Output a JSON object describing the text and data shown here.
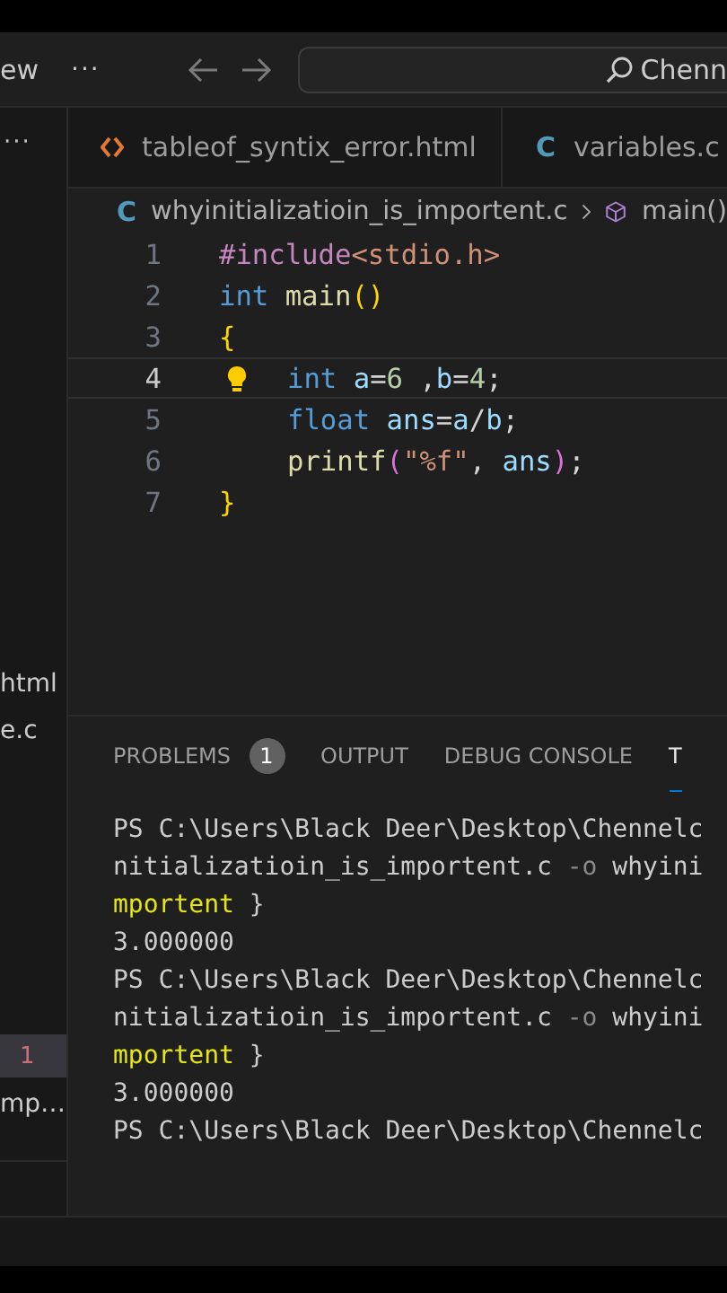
{
  "title_bar": {
    "menu_label": "ew",
    "more": "···",
    "search": {
      "value": "Chenn"
    }
  },
  "sidebar": {
    "more": "···",
    "items": [
      {
        "label": "html"
      },
      {
        "label": "e.c"
      }
    ],
    "badge_row": {
      "badge": "1"
    },
    "last_item": {
      "label": "mp…"
    }
  },
  "tabs": [
    {
      "label": "tableof_syntix_error.html",
      "kind": "html"
    },
    {
      "label": "variables.c",
      "kind": "c",
      "icon": "C"
    }
  ],
  "breadcrumb": {
    "icon": "C",
    "file": "whyinitializatioin_is_importent.c",
    "symbol": "main()"
  },
  "code_lines": [
    {
      "number": "1",
      "current": false,
      "indented": false,
      "lightbulb": false,
      "tokens": [
        {
          "text": "#include",
          "kind": "directive"
        },
        {
          "text": "<stdio.h>",
          "kind": "header"
        }
      ]
    },
    {
      "number": "2",
      "current": false,
      "indented": false,
      "lightbulb": false,
      "tokens": [
        {
          "text": "int",
          "kind": "keyword"
        },
        {
          "text": " main",
          "kind": "function"
        },
        {
          "text": "()",
          "kind": "bracket"
        }
      ]
    },
    {
      "number": "3",
      "current": false,
      "indented": false,
      "lightbulb": false,
      "tokens": [
        {
          "text": "{",
          "kind": "bracket"
        }
      ]
    },
    {
      "number": "4",
      "current": true,
      "indented": true,
      "lightbulb": true,
      "tokens": [
        {
          "text": "int",
          "kind": "keyword"
        },
        {
          "text": " a",
          "kind": "variable"
        },
        {
          "text": "=",
          "kind": "plain"
        },
        {
          "text": "6",
          "kind": "number"
        },
        {
          "text": " ,",
          "kind": "plain"
        },
        {
          "text": "b",
          "kind": "variable"
        },
        {
          "text": "=",
          "kind": "plain"
        },
        {
          "text": "4",
          "kind": "number"
        },
        {
          "text": ";",
          "kind": "plain"
        }
      ]
    },
    {
      "number": "5",
      "current": false,
      "indented": true,
      "lightbulb": false,
      "tokens": [
        {
          "text": "float",
          "kind": "keyword"
        },
        {
          "text": " ans",
          "kind": "variable"
        },
        {
          "text": "=",
          "kind": "plain"
        },
        {
          "text": "a",
          "kind": "variable"
        },
        {
          "text": "/",
          "kind": "plain"
        },
        {
          "text": "b",
          "kind": "variable"
        },
        {
          "text": ";",
          "kind": "plain"
        }
      ]
    },
    {
      "number": "6",
      "current": false,
      "indented": true,
      "lightbulb": false,
      "tokens": [
        {
          "text": "printf",
          "kind": "function"
        },
        {
          "text": "(",
          "kind": "bracket2"
        },
        {
          "text": "\"%f\"",
          "kind": "string"
        },
        {
          "text": ",",
          "kind": "plain"
        },
        {
          "text": " ans",
          "kind": "variable"
        },
        {
          "text": ")",
          "kind": "bracket2"
        },
        {
          "text": ";",
          "kind": "plain"
        }
      ]
    },
    {
      "number": "7",
      "current": false,
      "indented": false,
      "lightbulb": false,
      "tokens": [
        {
          "text": "}",
          "kind": "bracket"
        }
      ]
    }
  ],
  "panel_tabs": [
    {
      "label": "PROBLEMS",
      "badge": "1",
      "selected": false
    },
    {
      "label": "OUTPUT",
      "selected": false
    },
    {
      "label": "DEBUG CONSOLE",
      "selected": false
    },
    {
      "label": "T",
      "selected": true
    }
  ],
  "terminal_lines": [
    [
      {
        "text": "PS C:\\Users\\Black Deer\\Desktop\\Chennelc",
        "kind": "plain"
      }
    ],
    [
      {
        "text": "nitializatioin_is_importent.c ",
        "kind": "plain"
      },
      {
        "text": "-o",
        "kind": "flag"
      },
      {
        "text": " whyini",
        "kind": "plain"
      }
    ],
    [
      {
        "text": "mportent",
        "kind": "command"
      },
      {
        "text": " }",
        "kind": "plain"
      }
    ],
    [
      {
        "text": "3.000000",
        "kind": "plain"
      }
    ],
    [
      {
        "text": "PS C:\\Users\\Black Deer\\Desktop\\Chennelc",
        "kind": "plain"
      }
    ],
    [
      {
        "text": "nitializatioin_is_importent.c ",
        "kind": "plain"
      },
      {
        "text": "-o",
        "kind": "flag"
      },
      {
        "text": " whyini",
        "kind": "plain"
      }
    ],
    [
      {
        "text": "mportent",
        "kind": "command"
      },
      {
        "text": " }",
        "kind": "plain"
      }
    ],
    [
      {
        "text": "3.000000",
        "kind": "plain"
      }
    ],
    [
      {
        "text": "PS C:\\Users\\Black Deer\\Desktop\\Chennelc",
        "kind": "plain"
      }
    ]
  ]
}
